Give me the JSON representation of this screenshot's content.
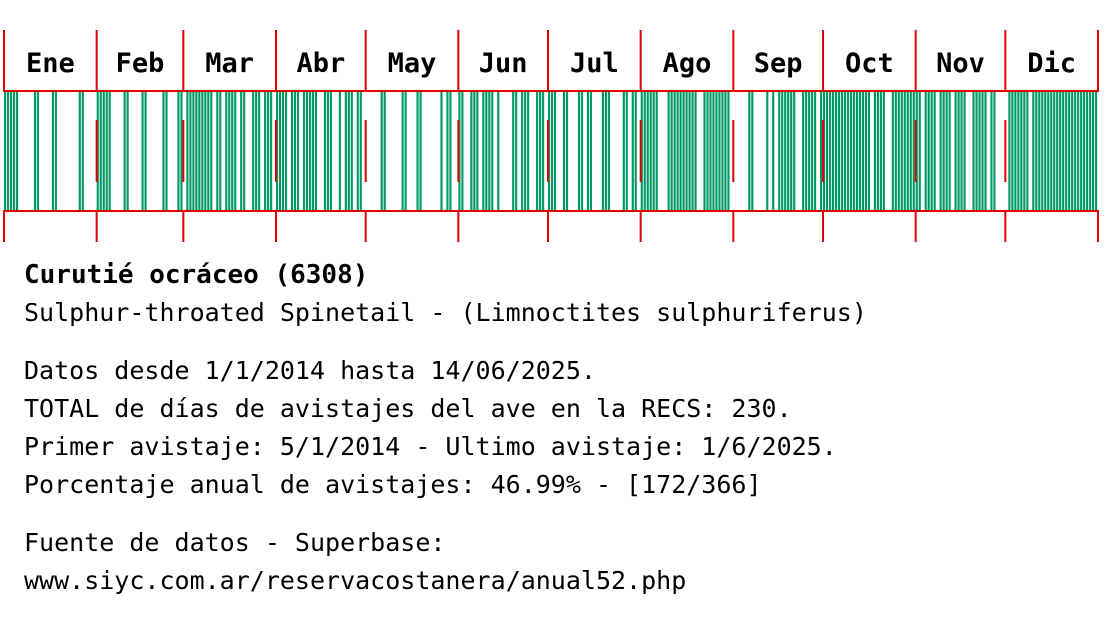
{
  "chart_data": {
    "type": "heatmap",
    "description_axis": "day of year",
    "months": [
      "Ene",
      "Feb",
      "Mar",
      "Abr",
      "May",
      "Jun",
      "Jul",
      "Ago",
      "Sep",
      "Oct",
      "Nov",
      "Dic"
    ],
    "days_in_month": [
      31,
      29,
      31,
      30,
      31,
      30,
      31,
      31,
      30,
      31,
      30,
      31
    ],
    "total_days": 366,
    "sighting_days": [
      1,
      2,
      3,
      4,
      5,
      11,
      12,
      17,
      18,
      26,
      27,
      32,
      33,
      34,
      35,
      36,
      41,
      42,
      47,
      48,
      54,
      55,
      59,
      60,
      62,
      63,
      64,
      65,
      66,
      67,
      68,
      69,
      70,
      72,
      73,
      75,
      76,
      77,
      78,
      80,
      81,
      84,
      85,
      86,
      88,
      89,
      90,
      92,
      93,
      94,
      95,
      97,
      98,
      99,
      101,
      102,
      103,
      104,
      105,
      108,
      109,
      110,
      113,
      115,
      116,
      117,
      119,
      120,
      127,
      128,
      134,
      135,
      139,
      140,
      147,
      149,
      150,
      153,
      154,
      157,
      158,
      159,
      161,
      162,
      163,
      164,
      166,
      171,
      172,
      174,
      175,
      176,
      179,
      180,
      181,
      183,
      184,
      185,
      188,
      189,
      193,
      194,
      196,
      197,
      201,
      202,
      203,
      208,
      209,
      211,
      212,
      214,
      215,
      216,
      217,
      218,
      219,
      223,
      224,
      225,
      226,
      227,
      228,
      229,
      230,
      231,
      232,
      235,
      236,
      237,
      238,
      239,
      240,
      241,
      242,
      243,
      250,
      251,
      256,
      258,
      260,
      261,
      262,
      263,
      264,
      265,
      268,
      269,
      270,
      271,
      272,
      274,
      275,
      276,
      277,
      278,
      279,
      280,
      281,
      282,
      283,
      284,
      285,
      286,
      287,
      288,
      289,
      290,
      292,
      293,
      294,
      295,
      298,
      299,
      300,
      301,
      302,
      303,
      304,
      305,
      306,
      307,
      309,
      310,
      311,
      312,
      314,
      315,
      316,
      317,
      319,
      320,
      321,
      322,
      325,
      326,
      327,
      328,
      329,
      331,
      332,
      337,
      338,
      339,
      340,
      341,
      342,
      343,
      345,
      346,
      347,
      348,
      349,
      350,
      351,
      352,
      353,
      354,
      355,
      356,
      357,
      358,
      359,
      360,
      361,
      362,
      363,
      364,
      365,
      366
    ],
    "sighting_days_count": 230,
    "colors": {
      "sighting": "#009966",
      "grid": "#e00000",
      "background": "#ffffff"
    }
  },
  "info": {
    "title": "Curutié ocráceo (6308)",
    "subtitle": "Sulphur-throated Spinetail - (Limnoctites sulphuriferus)",
    "data_range": "Datos desde 1/1/2014 hasta 14/06/2025.",
    "total": "TOTAL de días de avistajes del ave en la RECS: 230.",
    "first_last": "Primer avistaje: 5/1/2014 - Ultimo avistaje: 1/6/2025.",
    "percentage": "Porcentaje anual de avistajes: 46.99% - [172/366]",
    "source_label": "Fuente de datos - Superbase:",
    "source_url": "www.siyc.com.ar/reservacostanera/anual52.php"
  }
}
